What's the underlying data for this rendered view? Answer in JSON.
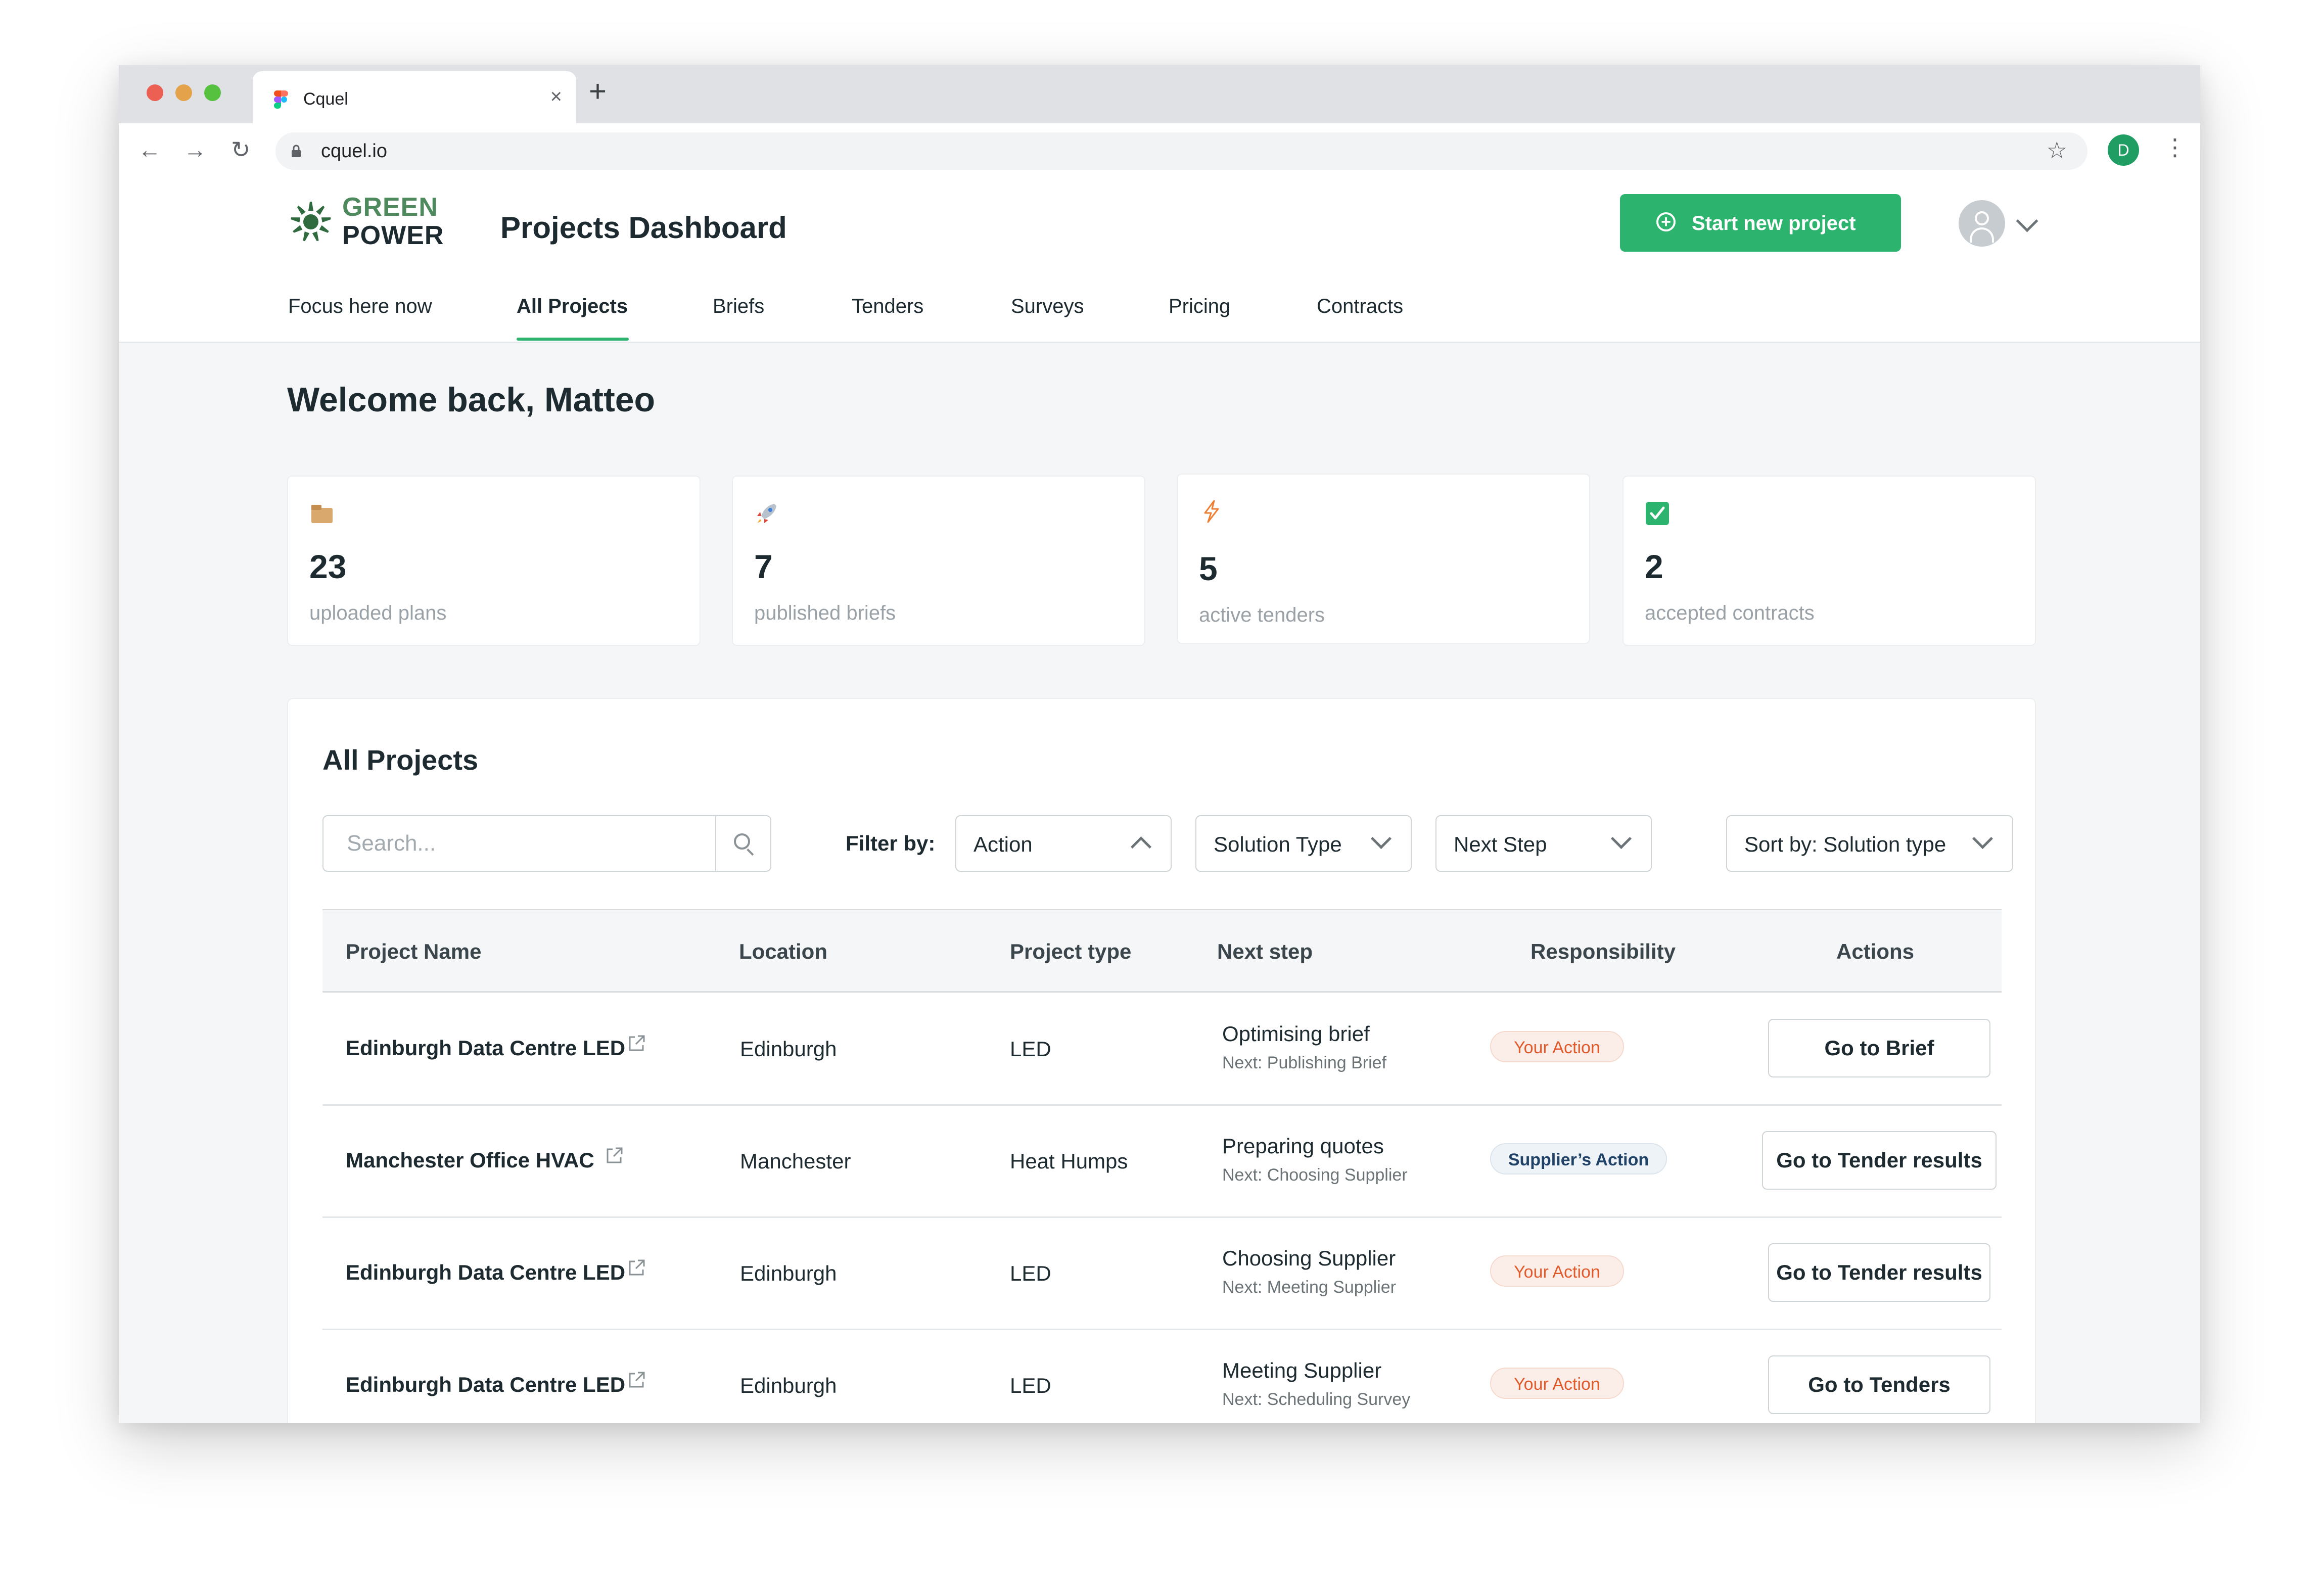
{
  "browser": {
    "tab_title": "Cquel",
    "close_glyph": "×",
    "new_tab_glyph": "+",
    "url": "cquel.io",
    "profile_initial": "D",
    "back_glyph": "←",
    "forward_glyph": "→",
    "reload_glyph": "↻",
    "star_glyph": "☆",
    "menu_glyph": "⋮"
  },
  "header": {
    "logo_line1": "GREEN",
    "logo_line2": "POWER",
    "page_title": "Projects Dashboard",
    "start_button_label": "Start new project",
    "accent_color": "#2cb36d"
  },
  "nav": {
    "tabs": [
      {
        "label": "Focus here now"
      },
      {
        "label": "All Projects",
        "active": true
      },
      {
        "label": "Briefs"
      },
      {
        "label": "Tenders"
      },
      {
        "label": "Surveys"
      },
      {
        "label": "Pricing"
      },
      {
        "label": "Contracts"
      }
    ]
  },
  "welcome": "Welcome back, Matteo",
  "stats": [
    {
      "icon": "box-icon",
      "value": "23",
      "label": "uploaded plans"
    },
    {
      "icon": "rocket-icon",
      "value": "7",
      "label": "published briefs"
    },
    {
      "icon": "lightning-icon",
      "value": "5",
      "label": "active tenders"
    },
    {
      "icon": "checkbox-icon",
      "value": "2",
      "label": "accepted contracts"
    }
  ],
  "projects": {
    "title": "All Projects",
    "search_placeholder": "Search...",
    "filter_label": "Filter by:",
    "filters": [
      "Action",
      "Solution Type",
      "Next Step"
    ],
    "sort_label": "Sort by: Solution type",
    "columns": [
      "Project Name",
      "Location",
      "Project type",
      "Next step",
      "Responsibility",
      "Actions"
    ],
    "rows": [
      {
        "name": "Edinburgh Data Centre LED",
        "location": "Edinburgh",
        "type": "LED",
        "step": "Optimising brief",
        "next": "Next: Publishing Brief",
        "responsibility": "Your Action",
        "action": "Go to Brief"
      },
      {
        "name": "Manchester Office HVAC",
        "location": "Manchester",
        "type": "Heat Humps",
        "step": "Preparing quotes",
        "next": "Next: Choosing Supplier",
        "responsibility": "Supplier’s Action",
        "action": "Go to Tender results"
      },
      {
        "name": "Edinburgh Data Centre LED",
        "location": "Edinburgh",
        "type": "LED",
        "step": "Choosing Supplier",
        "next": "Next: Meeting Supplier",
        "responsibility": "Your Action",
        "action": "Go to Tender results"
      },
      {
        "name": "Edinburgh Data Centre LED",
        "location": "Edinburgh",
        "type": "LED",
        "step": "Meeting Supplier",
        "next": "Next: Scheduling Survey",
        "responsibility": "Your Action",
        "action": "Go to Tenders"
      }
    ]
  }
}
